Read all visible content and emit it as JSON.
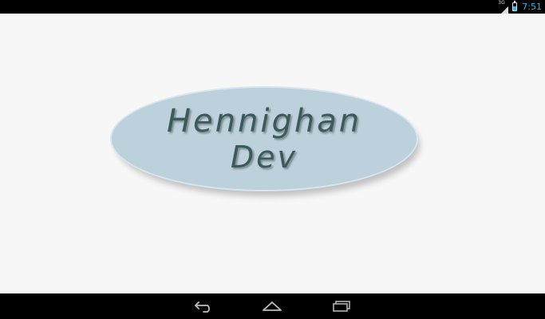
{
  "status_bar": {
    "network_type": "3G",
    "time": "7:51",
    "battery_level_percent": 60,
    "icons": [
      "signal-icon",
      "battery-icon"
    ]
  },
  "splash": {
    "logo_line1": "Hennighan",
    "logo_line2": "Dev",
    "logo_fill_color": "#bcd1dc",
    "logo_text_color": "#3d5a5a"
  },
  "nav_bar": {
    "icons": [
      "back-icon",
      "home-icon",
      "recent-apps-icon"
    ]
  },
  "colors": {
    "accent": "#33b5e5",
    "background": "#f7f7f7",
    "bars": "#000000"
  }
}
